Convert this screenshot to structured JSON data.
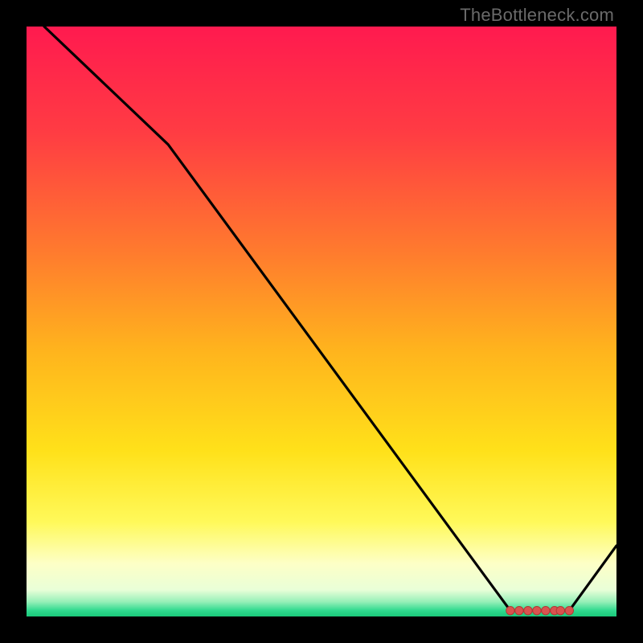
{
  "watermark": "TheBottleneck.com",
  "colors": {
    "bg": "#000000",
    "curve": "#000000",
    "marker_fill": "#d9534f",
    "marker_stroke": "#b03a36",
    "gradient_stops": [
      {
        "offset": 0.0,
        "color": "#ff1a4f"
      },
      {
        "offset": 0.18,
        "color": "#ff3c43"
      },
      {
        "offset": 0.38,
        "color": "#ff7a2e"
      },
      {
        "offset": 0.55,
        "color": "#ffb41d"
      },
      {
        "offset": 0.72,
        "color": "#ffe11a"
      },
      {
        "offset": 0.84,
        "color": "#fff95a"
      },
      {
        "offset": 0.91,
        "color": "#fdffc6"
      },
      {
        "offset": 0.955,
        "color": "#e9ffd8"
      },
      {
        "offset": 0.975,
        "color": "#97f0b8"
      },
      {
        "offset": 0.99,
        "color": "#2fd98e"
      },
      {
        "offset": 1.0,
        "color": "#19c87a"
      }
    ]
  },
  "chart_data": {
    "type": "line",
    "title": "",
    "xlabel": "",
    "ylabel": "",
    "xlim": [
      0,
      100
    ],
    "ylim": [
      0,
      100
    ],
    "series": [
      {
        "name": "curve",
        "x": [
          3,
          24,
          82,
          92,
          100
        ],
        "values": [
          100,
          80,
          1,
          1,
          12
        ]
      }
    ],
    "markers": {
      "name": "optimal-range",
      "x": [
        82,
        83.5,
        85,
        86.5,
        88,
        89.5,
        90.5,
        92
      ],
      "values": [
        1,
        1,
        1,
        1,
        1,
        1,
        1,
        1
      ]
    }
  }
}
